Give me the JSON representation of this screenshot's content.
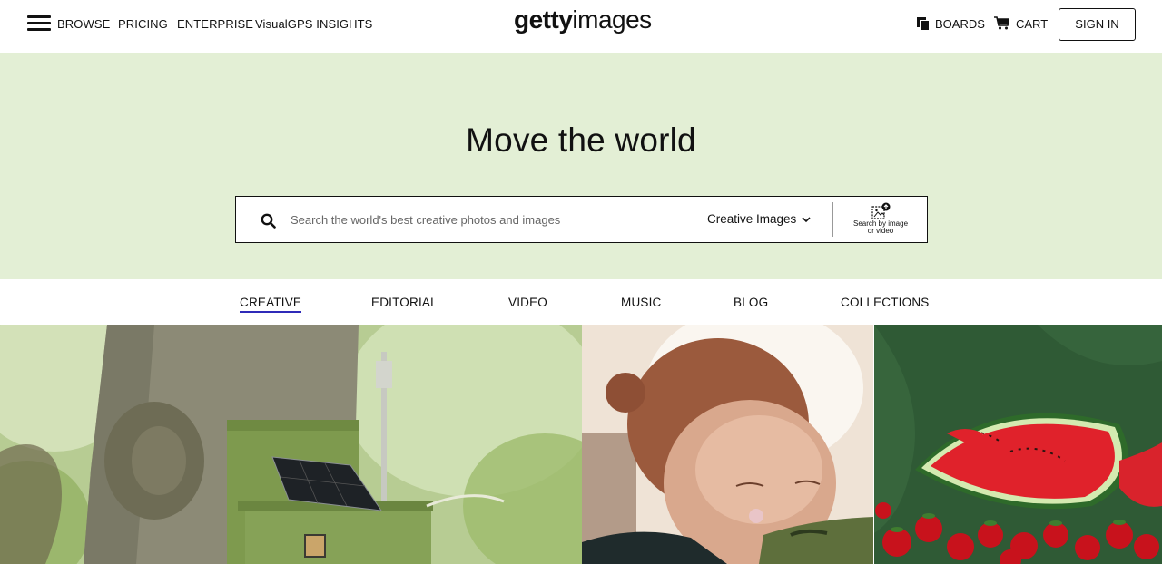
{
  "nav": {
    "browse": "BROWSE",
    "pricing": "PRICING",
    "enterprise": "ENTERPRISE",
    "insights": "VisualGPS INSIGHTS",
    "logo_bold": "getty",
    "logo_light": "images",
    "boards": "BOARDS",
    "cart": "CART",
    "sign_in": "SIGN IN"
  },
  "hero": {
    "title": "Move the world",
    "search": {
      "placeholder": "Search the world's best creative photos and images",
      "value": "",
      "type_selected": "Creative Images",
      "visual_search_label_line1": "Search by image",
      "visual_search_label_line2": "or video"
    },
    "background_color": "#e3efd5"
  },
  "tabs": [
    {
      "label": "CREATIVE",
      "active": true
    },
    {
      "label": "EDITORIAL",
      "active": false
    },
    {
      "label": "VIDEO",
      "active": false
    },
    {
      "label": "MUSIC",
      "active": false
    },
    {
      "label": "BLOG",
      "active": false
    },
    {
      "label": "COLLECTIONS",
      "active": false
    }
  ],
  "accent_color": "#2f2ab8",
  "icons": {
    "menu": "hamburger-menu-icon",
    "boards": "boards-icon",
    "cart": "cart-icon",
    "search": "search-icon",
    "chevron": "chevron-down-icon",
    "visual_search": "image-upload-icon"
  }
}
